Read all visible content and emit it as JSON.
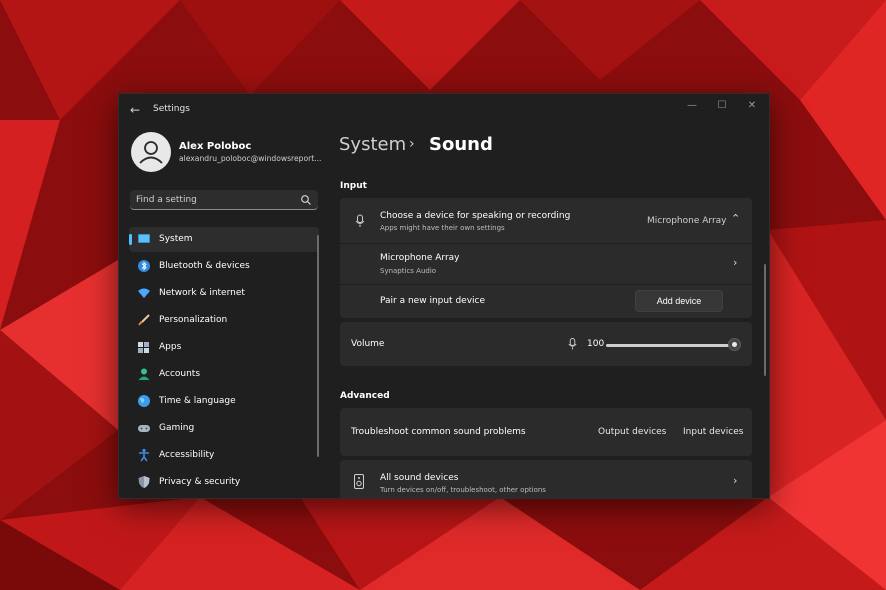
{
  "window": {
    "title": "Settings",
    "back_label": "←",
    "minimize": "—",
    "maximize": "☐",
    "close": "✕"
  },
  "user": {
    "name": "Alex Poloboc",
    "email": "alexandru_poloboc@windowsreport..."
  },
  "search": {
    "placeholder": "Find a setting"
  },
  "nav": [
    {
      "label": "System",
      "icon": "system-icon",
      "active": true
    },
    {
      "label": "Bluetooth & devices",
      "icon": "bluetooth-icon"
    },
    {
      "label": "Network & internet",
      "icon": "wifi-icon"
    },
    {
      "label": "Personalization",
      "icon": "brush-icon"
    },
    {
      "label": "Apps",
      "icon": "apps-icon"
    },
    {
      "label": "Accounts",
      "icon": "accounts-icon"
    },
    {
      "label": "Time & language",
      "icon": "globe-icon"
    },
    {
      "label": "Gaming",
      "icon": "gamepad-icon"
    },
    {
      "label": "Accessibility",
      "icon": "accessibility-icon"
    },
    {
      "label": "Privacy & security",
      "icon": "shield-icon"
    }
  ],
  "breadcrumb": {
    "parent": "System",
    "separator": "›",
    "current": "Sound"
  },
  "input": {
    "section_label": "Input",
    "choose": {
      "title": "Choose a device for speaking or recording",
      "subtitle": "Apps might have their own settings",
      "value": "Microphone Array"
    },
    "device": {
      "name": "Microphone Array",
      "subtitle": "Synaptics Audio"
    },
    "pair": {
      "label": "Pair a new input device",
      "button": "Add device"
    },
    "volume": {
      "label": "Volume",
      "value": "100",
      "level": 1.0
    }
  },
  "advanced": {
    "section_label": "Advanced",
    "troubleshoot": {
      "label": "Troubleshoot common sound problems",
      "output_link": "Output devices",
      "input_link": "Input devices"
    },
    "all_devices": {
      "title": "All sound devices",
      "subtitle": "Turn devices on/off, troubleshoot, other options"
    }
  },
  "colors": {
    "accent": "#4cc2ff",
    "window_bg": "#1f1f1f",
    "card_bg": "#2b2b2b",
    "wallpaper": "#8c0d0d"
  }
}
